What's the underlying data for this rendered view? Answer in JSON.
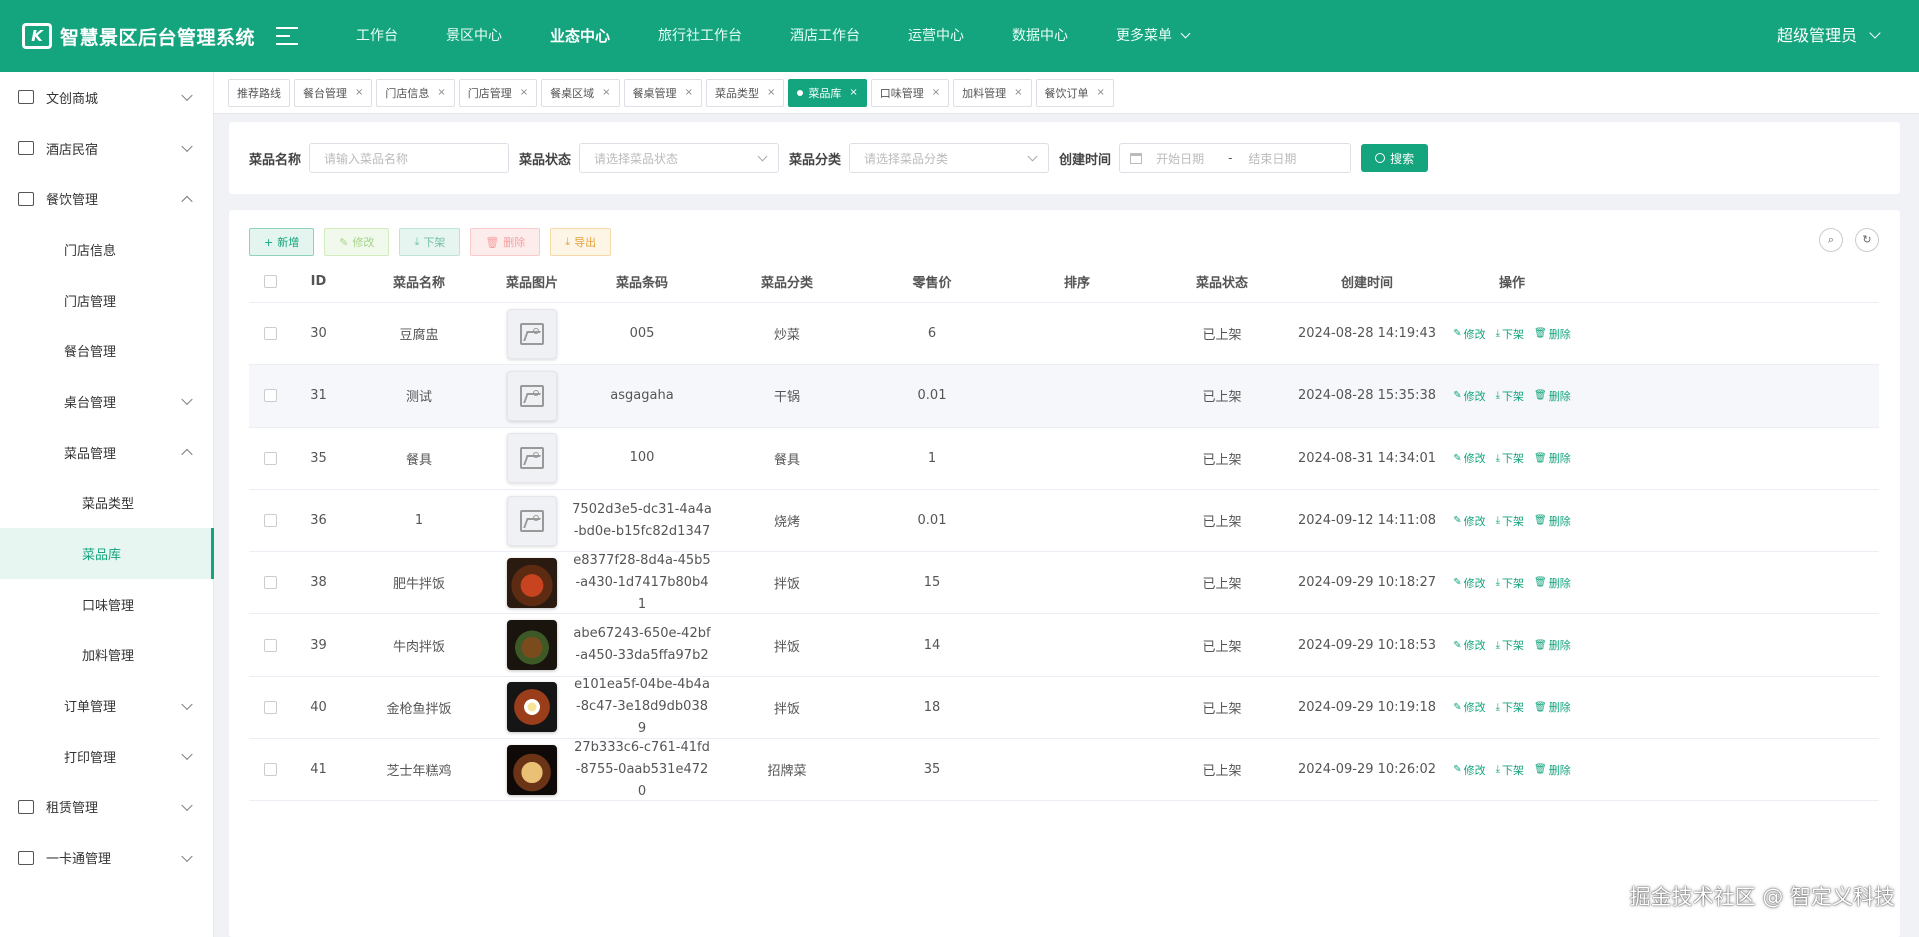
{
  "app": {
    "title": "智慧景区后台管理系统",
    "logo_mark": "K"
  },
  "nav": [
    "工作台",
    "景区中心",
    "业态中心",
    "旅行社工作台",
    "酒店工作台",
    "运营中心",
    "数据中心",
    "更多菜单"
  ],
  "nav_active_index": 2,
  "user": {
    "name": "超级管理员"
  },
  "sidebar": [
    {
      "label": "文创商城",
      "level": 1,
      "icon": "book-icon",
      "arrow": "down"
    },
    {
      "label": "酒店民宿",
      "level": 1,
      "icon": "building-icon",
      "arrow": "down"
    },
    {
      "label": "餐饮管理",
      "level": 1,
      "icon": "dining-icon",
      "arrow": "up"
    },
    {
      "label": "门店信息",
      "level": 2
    },
    {
      "label": "门店管理",
      "level": 2
    },
    {
      "label": "餐台管理",
      "level": 2
    },
    {
      "label": "桌台管理",
      "level": 2,
      "arrow": "down"
    },
    {
      "label": "菜品管理",
      "level": 2,
      "arrow": "up"
    },
    {
      "label": "菜品类型",
      "level": 3
    },
    {
      "label": "菜品库",
      "level": 3,
      "active": true
    },
    {
      "label": "口味管理",
      "level": 3
    },
    {
      "label": "加料管理",
      "level": 3
    },
    {
      "label": "订单管理",
      "level": 2,
      "arrow": "down"
    },
    {
      "label": "打印管理",
      "level": 2,
      "arrow": "down"
    },
    {
      "label": "租赁管理",
      "level": 1,
      "icon": "logout-icon",
      "arrow": "down"
    },
    {
      "label": "一卡通管理",
      "level": 1,
      "icon": "card-icon",
      "arrow": "down"
    }
  ],
  "tabs": [
    "推荐路线",
    "餐台管理",
    "门店信息",
    "门店管理",
    "餐桌区域",
    "餐桌管理",
    "菜品类型",
    "菜品库",
    "口味管理",
    "加料管理",
    "餐饮订单"
  ],
  "tab_active_index": 7,
  "search": {
    "name_label": "菜品名称",
    "name_placeholder": "请输入菜品名称",
    "status_label": "菜品状态",
    "status_placeholder": "请选择菜品状态",
    "category_label": "菜品分类",
    "category_placeholder": "请选择菜品分类",
    "time_label": "创建时间",
    "start_placeholder": "开始日期",
    "separator": "-",
    "end_placeholder": "结束日期",
    "search_button": "搜索"
  },
  "toolbar": {
    "add": "新增",
    "edit": "修改",
    "down": "下架",
    "delete": "删除",
    "export": "导出"
  },
  "table": {
    "headers": [
      "ID",
      "菜品名称",
      "菜品图片",
      "菜品条码",
      "菜品分类",
      "零售价",
      "排序",
      "菜品状态",
      "创建时间",
      "操作"
    ],
    "row_actions": [
      "修改",
      "下架",
      "删除"
    ],
    "rows": [
      {
        "id": "30",
        "name": "豆腐盅",
        "image": "placeholder",
        "code": "005",
        "category": "炒菜",
        "price": "6",
        "sort": "",
        "status": "已上架",
        "created": "2024-08-28 14:19:43"
      },
      {
        "id": "31",
        "name": "测试",
        "image": "placeholder",
        "code": "asgagaha",
        "category": "干锅",
        "price": "0.01",
        "sort": "",
        "status": "已上架",
        "created": "2024-08-28 15:35:38"
      },
      {
        "id": "35",
        "name": "餐具",
        "image": "placeholder",
        "code": "100",
        "category": "餐具",
        "price": "1",
        "sort": "",
        "status": "已上架",
        "created": "2024-08-31 14:34:01"
      },
      {
        "id": "36",
        "name": "1",
        "image": "placeholder",
        "code": "7502d3e5-dc31-4a4a-bd0e-b15fc82d1347",
        "category": "烧烤",
        "price": "0.01",
        "sort": "",
        "status": "已上架",
        "created": "2024-09-12 14:11:08"
      },
      {
        "id": "38",
        "name": "肥牛拌饭",
        "image": "food-photo",
        "code": "e8377f28-8d4a-45b5-a430-1d7417b80b41",
        "category": "拌饭",
        "price": "15",
        "sort": "",
        "status": "已上架",
        "created": "2024-09-29 10:18:27"
      },
      {
        "id": "39",
        "name": "牛肉拌饭",
        "image": "food-photo",
        "code": "abe67243-650e-42bf-a450-33da5ffa97b2",
        "category": "拌饭",
        "price": "14",
        "sort": "",
        "status": "已上架",
        "created": "2024-09-29 10:18:53"
      },
      {
        "id": "40",
        "name": "金枪鱼拌饭",
        "image": "food-photo",
        "code": "e101ea5f-04be-4b4a-8c47-3e18d9db0389",
        "category": "拌饭",
        "price": "18",
        "sort": "",
        "status": "已上架",
        "created": "2024-09-29 10:19:18"
      },
      {
        "id": "41",
        "name": "芝士年糕鸡",
        "image": "food-photo",
        "code": "27b333c6-c761-41fd-8755-0aab531e4720",
        "category": "招牌菜",
        "price": "35",
        "sort": "",
        "status": "已上架",
        "created": "2024-09-29 10:26:02"
      }
    ]
  },
  "watermark": "掘金技术社区 @ 智定义科技",
  "colors": {
    "primary": "#14a47e",
    "header_bg": "#14a47e",
    "danger": "#f56c6c",
    "warning": "#e6a23c"
  }
}
